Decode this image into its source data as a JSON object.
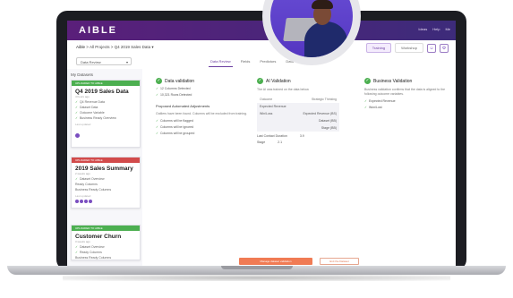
{
  "app": {
    "logo": "AIBLE",
    "topnav": [
      "Ideas",
      "Help",
      "Me"
    ]
  },
  "breadcrumb": {
    "home": "Aible",
    "sep1": ">",
    "projects": "All Projects",
    "sep2": ">",
    "current": "Q4 2019 Sales Data"
  },
  "toolbar": {
    "btn_primary": "Training",
    "btn_secondary": "Workshop"
  },
  "subbar": {
    "dropdown_value": "Data Review",
    "tabs": [
      "Data Review",
      "Fields",
      "Predictors",
      "Data"
    ]
  },
  "sidebar": {
    "title": "My Datasets",
    "cards": [
      {
        "status": "UPLOADED TO AIBLE",
        "title": "Q4 2019 Sales Data",
        "sub": "4 hours ago",
        "items": [
          "Q4 Revenue Data",
          "Dataset Data",
          "Outcome Variable",
          "Business Ready Overview"
        ],
        "mini": "Last updated",
        "foot": ""
      },
      {
        "status": "UPLOADED TO AIBLE",
        "title": "2019 Sales Summary",
        "sub": "2 weeks ago",
        "items": [
          "Dataset Overview",
          "Ready Columns",
          "Business Ready Columns"
        ],
        "mini": "Last updated",
        "foot": ""
      },
      {
        "status": "UPLOADED TO AIBLE",
        "title": "Customer Churn",
        "sub": "3 weeks ago",
        "items": [
          "Dataset Overview",
          "Ready Columns",
          "Business Ready Columns"
        ],
        "mini": "",
        "foot": ""
      }
    ]
  },
  "validation": {
    "data": {
      "title": "Data validation",
      "lines": [
        "12 Columns Detected",
        "10,321 Rows Detected"
      ],
      "sub": "Proposed Automated Adjustments",
      "text": "Outliers have been found. Columns will be excluded from training.",
      "adjust": [
        "Columns will be flagged",
        "Columns will be ignored",
        "Columns will be grouped"
      ]
    },
    "ai": {
      "title": "AI Validation",
      "text": "The AI was trained on the data below.",
      "table_head": [
        "Outcome",
        "Strategic Thinking"
      ],
      "rows": [
        [
          "Expected Revenue",
          ""
        ],
        [
          "Win/Loss",
          "Expected Revenue (BS)"
        ],
        [
          "",
          "Dataset (BB)"
        ],
        [
          "",
          "Stage (BB)"
        ]
      ],
      "kv": [
        [
          "Last Contact Duration",
          "3.9"
        ],
        [
          "Stage",
          "2.1"
        ]
      ]
    },
    "biz": {
      "title": "Business Validation",
      "text": "Business validation confirms that the data is aligned to the following outcome variables.",
      "lines": [
        "Expected Revenue",
        "Won/Lost"
      ]
    }
  },
  "actions": {
    "primary": "Manage dataset validation",
    "secondary": "Exit the Dataset"
  }
}
